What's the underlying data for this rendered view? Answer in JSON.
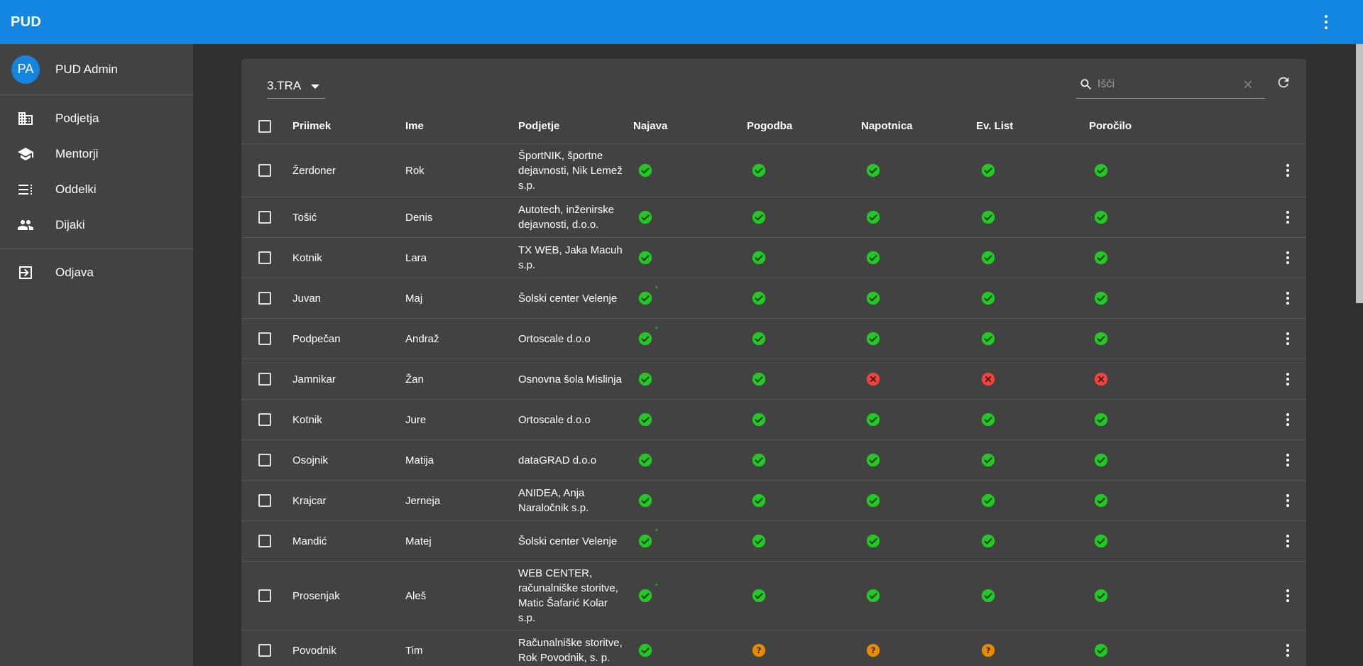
{
  "appbar": {
    "title": "PUD"
  },
  "user": {
    "initials": "PA",
    "name": "PUD Admin"
  },
  "nav": {
    "items": [
      {
        "icon": "business-icon",
        "label": "Podjetja"
      },
      {
        "icon": "school-icon",
        "label": "Mentorji"
      },
      {
        "icon": "list-icon",
        "label": "Oddelki"
      },
      {
        "icon": "people-icon",
        "label": "Dijaki"
      }
    ],
    "logout": {
      "icon": "logout-icon",
      "label": "Odjava"
    }
  },
  "toolbar": {
    "class_value": "3.TRA",
    "search_placeholder": "Išči"
  },
  "colors": {
    "ok": "#22c922",
    "error": "#f44336",
    "unknown": "#e68a00",
    "accent": "#1485e0"
  },
  "table": {
    "columns": [
      "Priimek",
      "Ime",
      "Podjetje",
      "Najava",
      "Pogodba",
      "Napotnica",
      "Ev. List",
      "Poročilo"
    ],
    "rows": [
      {
        "priimek": "Žerdoner",
        "ime": "Rok",
        "podjetje": "ŠportNIK, športne dejavnosti, Nik Lemež s.p.",
        "najava": "ok",
        "pogodba": "ok",
        "napotnica": "ok",
        "evlist": "ok",
        "porocilo": "ok"
      },
      {
        "priimek": "Tošić",
        "ime": "Denis",
        "podjetje": "Autotech, inženirske dejavnosti, d.o.o.",
        "najava": "ok",
        "pogodba": "ok",
        "napotnica": "ok",
        "evlist": "ok",
        "porocilo": "ok"
      },
      {
        "priimek": "Kotnik",
        "ime": "Lara",
        "podjetje": "TX WEB, Jaka Macuh s.p.",
        "najava": "ok",
        "pogodba": "ok",
        "napotnica": "ok",
        "evlist": "ok",
        "porocilo": "ok"
      },
      {
        "priimek": "Juvan",
        "ime": "Maj",
        "podjetje": "Šolski center Velenje",
        "najava": "ok-star",
        "pogodba": "ok",
        "napotnica": "ok",
        "evlist": "ok",
        "porocilo": "ok"
      },
      {
        "priimek": "Podpečan",
        "ime": "Andraž",
        "podjetje": "Ortoscale d.o.o",
        "najava": "ok-star",
        "pogodba": "ok",
        "napotnica": "ok",
        "evlist": "ok",
        "porocilo": "ok"
      },
      {
        "priimek": "Jamnikar",
        "ime": "Žan",
        "podjetje": "Osnovna šola Mislinja",
        "najava": "ok",
        "pogodba": "ok",
        "napotnica": "error",
        "evlist": "error",
        "porocilo": "error"
      },
      {
        "priimek": "Kotnik",
        "ime": "Jure",
        "podjetje": "Ortoscale d.o.o",
        "najava": "ok",
        "pogodba": "ok",
        "napotnica": "ok",
        "evlist": "ok",
        "porocilo": "ok"
      },
      {
        "priimek": "Osojnik",
        "ime": "Matija",
        "podjetje": "dataGRAD d.o.o",
        "najava": "ok",
        "pogodba": "ok",
        "napotnica": "ok",
        "evlist": "ok",
        "porocilo": "ok"
      },
      {
        "priimek": "Krajcar",
        "ime": "Jerneja",
        "podjetje": "ANIDEA, Anja Naraločnik s.p.",
        "najava": "ok",
        "pogodba": "ok",
        "napotnica": "ok",
        "evlist": "ok",
        "porocilo": "ok"
      },
      {
        "priimek": "Mandić",
        "ime": "Matej",
        "podjetje": "Šolski center Velenje",
        "najava": "ok-star",
        "pogodba": "ok",
        "napotnica": "ok",
        "evlist": "ok",
        "porocilo": "ok"
      },
      {
        "priimek": "Prosenjak",
        "ime": "Aleš",
        "podjetje": "WEB CENTER, računalniške storitve, Matic Šafarić Kolar s.p.",
        "najava": "ok-star",
        "pogodba": "ok",
        "napotnica": "ok",
        "evlist": "ok",
        "porocilo": "ok"
      },
      {
        "priimek": "Povodnik",
        "ime": "Tim",
        "podjetje": "Računalniške storitve, Rok Povodnik, s. p.",
        "najava": "ok",
        "pogodba": "unknown",
        "napotnica": "unknown",
        "evlist": "unknown",
        "porocilo": "ok"
      }
    ]
  }
}
